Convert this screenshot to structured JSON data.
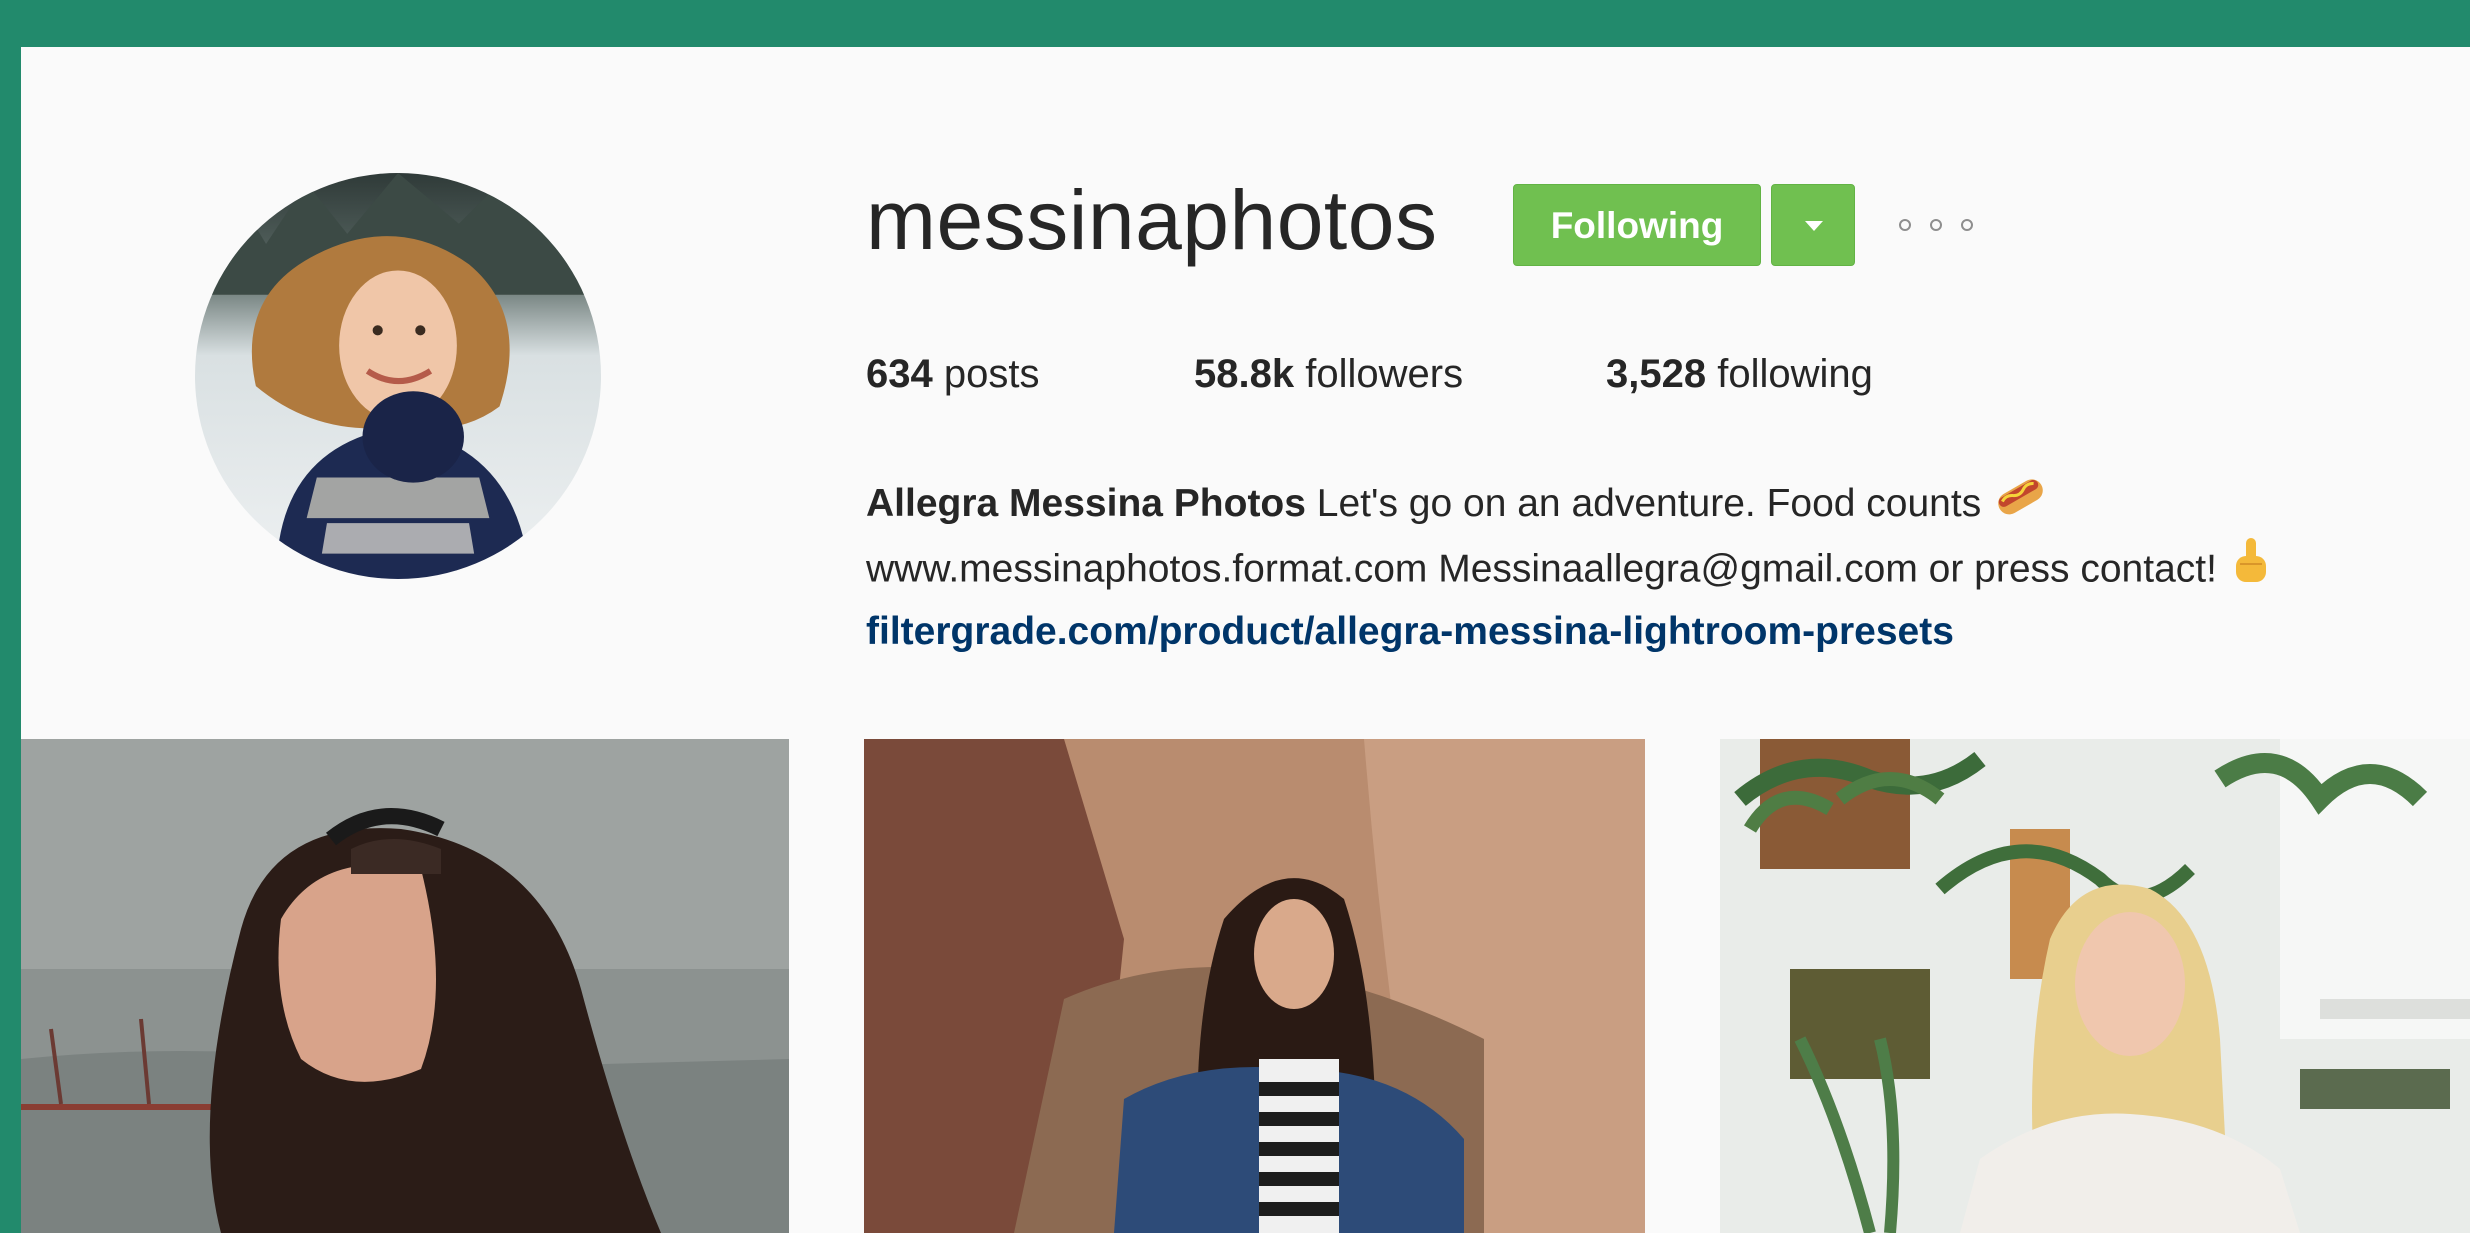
{
  "profile": {
    "username": "messinaphotos",
    "follow_button": "Following",
    "stats": {
      "posts_count": "634",
      "posts_label": "posts",
      "followers_count": "58.8k",
      "followers_label": "followers",
      "following_count": "3,528",
      "following_label": "following"
    },
    "bio": {
      "name": "Allegra Messina Photos",
      "line1": "Let's go on an adventure. Food counts",
      "line2": "www.messinaphotos.format.com Messinaallegra@gmail.com or press contact!",
      "link": "filtergrade.com/product/allegra-messina-lightroom-presets"
    }
  },
  "icons": {
    "hotdog": "hotdog-emoji",
    "pointing": "pointing-up-emoji",
    "more": "more-options-icon",
    "dropdown": "chevron-down-icon"
  },
  "colors": {
    "frame": "#228a6c",
    "button": "#70c050",
    "link": "#003569"
  }
}
